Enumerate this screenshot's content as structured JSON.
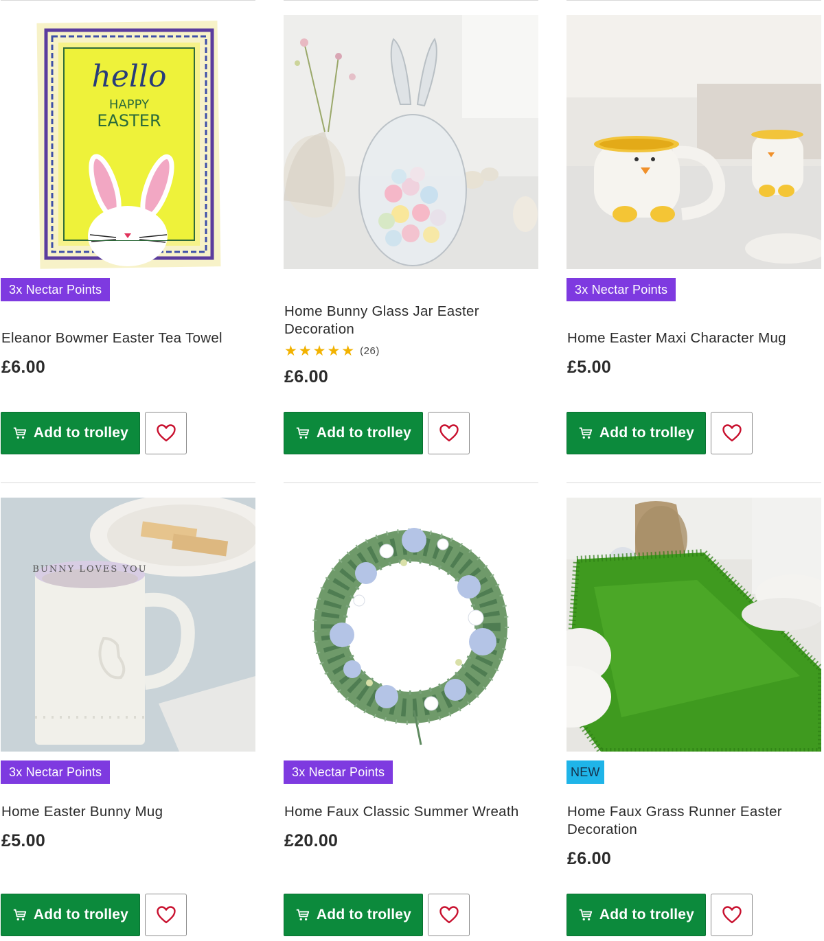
{
  "colors": {
    "nectar_badge": "#7e3ae0",
    "new_badge": "#1fb4e8",
    "add_button": "#0c8a3c",
    "heart": "#c8102e",
    "star": "#f2b200"
  },
  "add_label": "Add to trolley",
  "products": [
    {
      "badge": "3x Nectar Points",
      "title": "Eleanor Bowmer Easter Tea Towel",
      "price": "£6.00",
      "image_text": {
        "line1": "hello",
        "line2": "HAPPY",
        "line3": "EASTER"
      }
    },
    {
      "badge": "",
      "title": "Home Bunny Glass Jar Easter Decoration",
      "rating": 5,
      "rating_stars": "★★★★★",
      "rating_count": "(26)",
      "price": "£6.00"
    },
    {
      "badge": "3x Nectar Points",
      "title": "Home Easter Maxi Character Mug",
      "price": "£5.00"
    },
    {
      "badge": "3x Nectar Points",
      "title": "Home Easter Bunny Mug",
      "price": "£5.00",
      "image_text": "BUNNY LOVES YOU"
    },
    {
      "badge": "3x Nectar Points",
      "title": "Home Faux Classic Summer Wreath",
      "price": "£20.00"
    },
    {
      "badge": "NEW",
      "title": "Home Faux Grass Runner Easter Decoration",
      "price": "£6.00"
    }
  ]
}
